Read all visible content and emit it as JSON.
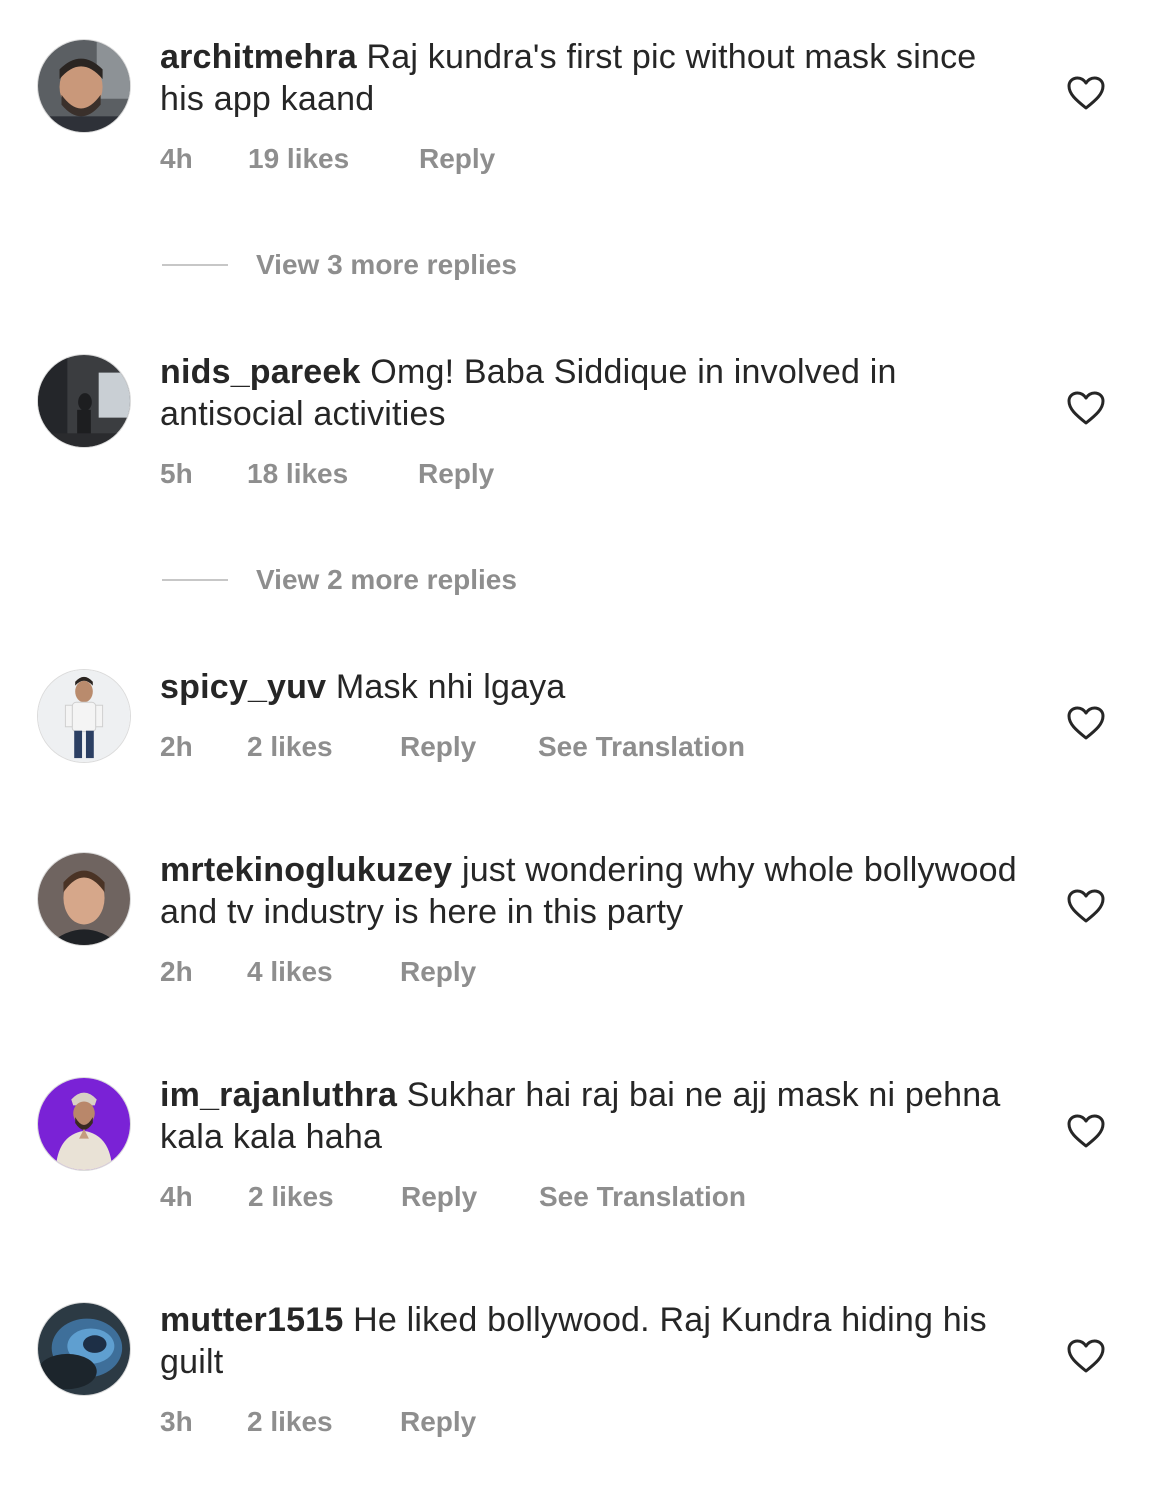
{
  "comments": [
    {
      "username": "architmehra",
      "text": "Raj kundra's first pic without mask since his app kaand",
      "time": "4h",
      "likes": "19 likes",
      "reply": "Reply",
      "translation": "",
      "view_more": "View 3 more replies"
    },
    {
      "username": "nids_pareek",
      "text": "Omg! Baba Siddique in involved in antisocial activities",
      "time": "5h",
      "likes": "18 likes",
      "reply": "Reply",
      "translation": "",
      "view_more": "View 2 more replies"
    },
    {
      "username": "spicy_yuv",
      "text": "Mask nhi lgaya",
      "time": "2h",
      "likes": "2 likes",
      "reply": "Reply",
      "translation": "See Translation",
      "view_more": ""
    },
    {
      "username": "mrtekinoglukuzey",
      "text": "just wondering why whole bollywood and tv industry is here in this party",
      "time": "2h",
      "likes": "4 likes",
      "reply": "Reply",
      "translation": "",
      "view_more": ""
    },
    {
      "username": "im_rajanluthra",
      "text": "Sukhar hai raj bai ne ajj mask ni pehna kala kala haha",
      "time": "4h",
      "likes": "2 likes",
      "reply": "Reply",
      "translation": "See Translation",
      "view_more": ""
    },
    {
      "username": "mutter1515",
      "text": "He liked bollywood. Raj Kundra hiding his guilt",
      "time": "3h",
      "likes": "2 likes",
      "reply": "Reply",
      "translation": "",
      "view_more": ""
    }
  ],
  "icons": {
    "like": "heart-outline-icon"
  },
  "colors": {
    "text": "#262626",
    "meta": "#8e8e8e",
    "divider": "#c7c7c7"
  }
}
